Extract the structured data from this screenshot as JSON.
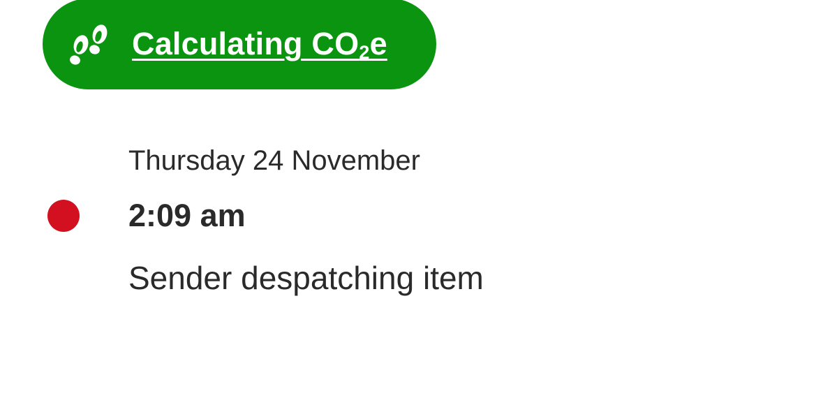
{
  "co2_link": {
    "label_main": "Calculating CO",
    "label_subscript": "2",
    "label_suffix": "e",
    "icon": "footprints-icon",
    "background_color": "#0a9410",
    "text_color": "#ffffff"
  },
  "tracking_event": {
    "date": "Thursday 24 November",
    "time": "2:09 am",
    "description": "Sender despatching item",
    "status_dot_color": "#d2101f"
  }
}
